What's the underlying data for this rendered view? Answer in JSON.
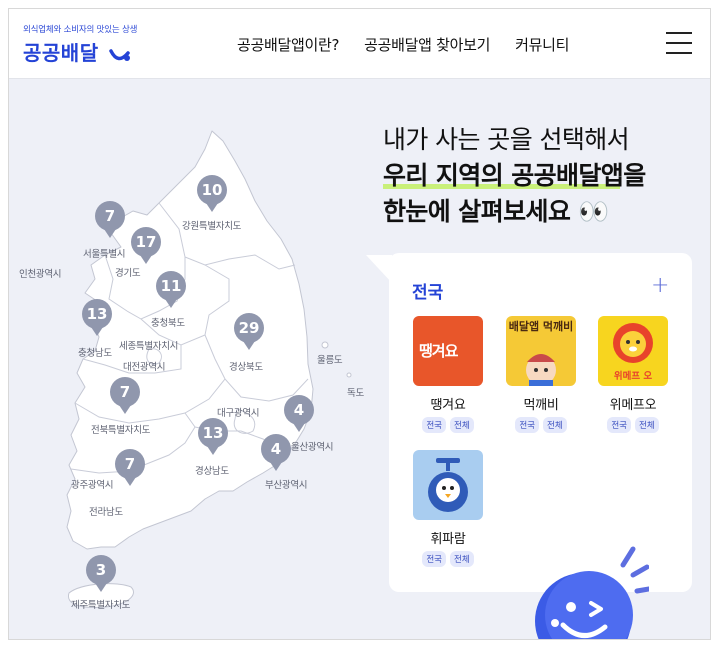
{
  "header": {
    "logo_tagline": "외식업체와 소비자의 맛있는 상생",
    "logo_name": "공공배달",
    "nav": [
      {
        "label": "공공배달앱이란?"
      },
      {
        "label": "공공배달앱 찾아보기"
      },
      {
        "label": "커뮤니티"
      }
    ]
  },
  "headline": {
    "line1": "내가 사는 곳을 선택해서",
    "line2": "우리 지역의 공공배달앱을",
    "line3": "한눈에 살펴보세요",
    "line3_emoji": "👀"
  },
  "map": {
    "regions": [
      {
        "name": "강원특별자치도"
      },
      {
        "name": "서울특별시"
      },
      {
        "name": "인천광역시"
      },
      {
        "name": "경기도"
      },
      {
        "name": "충청북도"
      },
      {
        "name": "세종특별자치시"
      },
      {
        "name": "충청남도"
      },
      {
        "name": "대전광역시"
      },
      {
        "name": "경상북도"
      },
      {
        "name": "울릉도"
      },
      {
        "name": "독도"
      },
      {
        "name": "대구광역시"
      },
      {
        "name": "전북특별자치도"
      },
      {
        "name": "울산광역시"
      },
      {
        "name": "경상남도"
      },
      {
        "name": "부산광역시"
      },
      {
        "name": "광주광역시"
      },
      {
        "name": "전라남도"
      },
      {
        "name": "제주특별자치도"
      }
    ],
    "pins": [
      {
        "region": "강원특별자치도",
        "count": "10"
      },
      {
        "region": "서울특별시",
        "count": "7"
      },
      {
        "region": "경기도",
        "count": "17"
      },
      {
        "region": "충청북도",
        "count": "11"
      },
      {
        "region": "충청남도",
        "count": "13"
      },
      {
        "region": "경상북도",
        "count": "29"
      },
      {
        "region": "전북특별자치도",
        "count": "7"
      },
      {
        "region": "울산광역시",
        "count": "4"
      },
      {
        "region": "경상남도",
        "count": "13"
      },
      {
        "region": "부산광역시",
        "count": "4"
      },
      {
        "region": "광주광역시",
        "count": "7"
      },
      {
        "region": "제주특별자치도",
        "count": "3"
      }
    ],
    "pin_color": "#9097ad"
  },
  "card": {
    "title": "전국",
    "plus": "+",
    "apps": [
      {
        "name": "땡겨요",
        "icon_text": "땡겨요",
        "tags": [
          "전국",
          "전체"
        ],
        "color": "#e8562a"
      },
      {
        "name": "먹깨비",
        "icon_text": "배달앱 먹깨비",
        "tags": [
          "전국",
          "전체"
        ],
        "color": "#f5c936"
      },
      {
        "name": "위메프오",
        "icon_text": "위메프 오",
        "tags": [
          "전국",
          "전체"
        ],
        "color": "#f7d51f"
      },
      {
        "name": "휘파람",
        "icon_text": "",
        "tags": [
          "전국",
          "전체"
        ],
        "color": "#a9cdf0"
      }
    ]
  },
  "colors": {
    "brand": "#2443d6",
    "highlight": "#c9f07a",
    "background": "#eef0f7"
  }
}
